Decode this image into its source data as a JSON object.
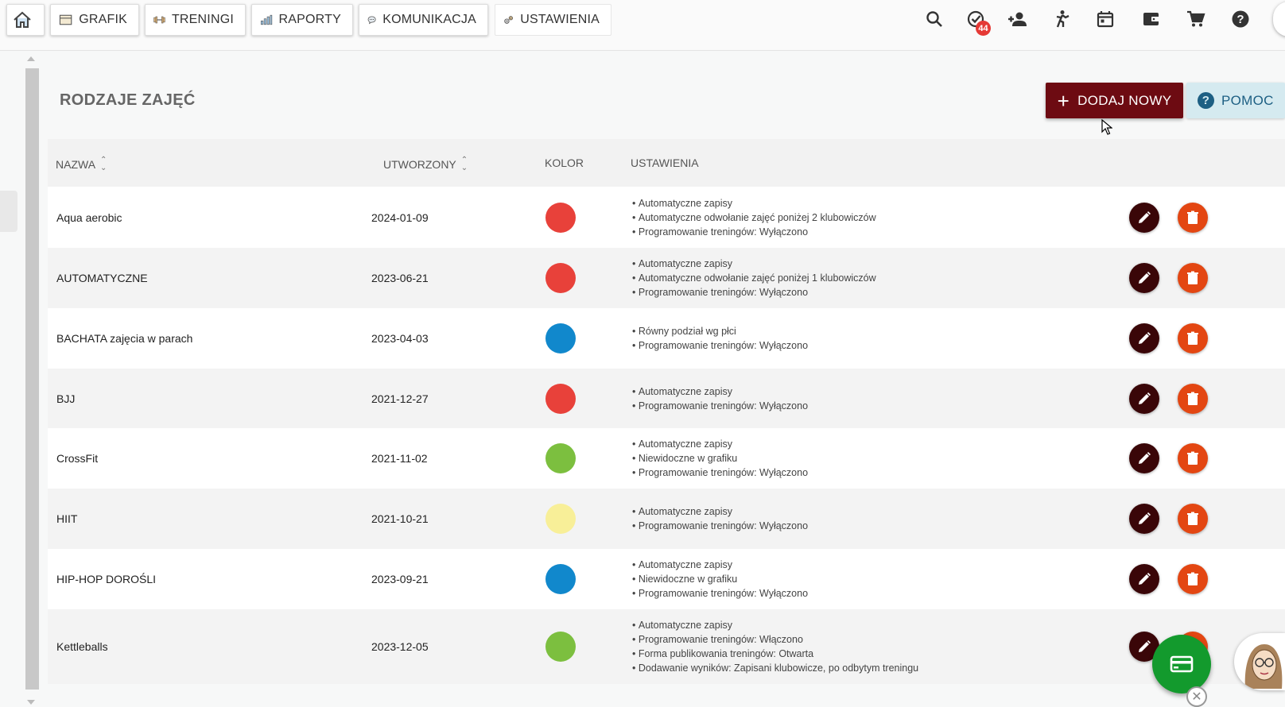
{
  "nav": {
    "items": [
      {
        "label": "GRAFIK",
        "icon": "calendar-grid-icon"
      },
      {
        "label": "TRENINGI",
        "icon": "dumbbell-icon"
      },
      {
        "label": "RAPORTY",
        "icon": "bar-chart-icon"
      },
      {
        "label": "KOMUNIKACJA",
        "icon": "chat-bubble-icon"
      },
      {
        "label": "USTAWIENIA",
        "icon": "gears-icon"
      }
    ],
    "tasks_badge": "44"
  },
  "page": {
    "title": "RODZAJE ZAJĘĆ",
    "add_button": "DODAJ NOWY",
    "help_button": "POMOC"
  },
  "table": {
    "headers": {
      "name": "NAZWA",
      "created": "UTWORZONY",
      "color": "KOLOR",
      "settings": "USTAWIENIA"
    },
    "rows": [
      {
        "name": "Aqua aerobic",
        "created": "2024-01-09",
        "color": "#e8413a",
        "settings": [
          "Automatyczne zapisy",
          "Automatyczne odwołanie zajęć poniżej 2 klubowiczów",
          "Programowanie treningów: Wyłączono"
        ]
      },
      {
        "name": "AUTOMATYCZNE",
        "created": "2023-06-21",
        "color": "#e8413a",
        "settings": [
          "Automatyczne zapisy",
          "Automatyczne odwołanie zajęć poniżej 1 klubowiczów",
          "Programowanie treningów: Wyłączono"
        ]
      },
      {
        "name": "BACHATA zajęcia w parach",
        "created": "2023-04-03",
        "color": "#1188cc",
        "settings": [
          "Równy podział wg płci",
          "Programowanie treningów: Wyłączono"
        ]
      },
      {
        "name": "BJJ",
        "created": "2021-12-27",
        "color": "#e8413a",
        "settings": [
          "Automatyczne zapisy",
          "Programowanie treningów: Wyłączono"
        ]
      },
      {
        "name": "CrossFit",
        "created": "2021-11-02",
        "color": "#7cbf3f",
        "settings": [
          "Automatyczne zapisy",
          "Niewidoczne w grafiku",
          "Programowanie treningów: Wyłączono"
        ]
      },
      {
        "name": "HIIT",
        "created": "2021-10-21",
        "color": "#f8ef98",
        "settings": [
          "Automatyczne zapisy",
          "Programowanie treningów: Wyłączono"
        ]
      },
      {
        "name": "HIP-HOP DOROŚLI",
        "created": "2023-09-21",
        "color": "#1188cc",
        "settings": [
          "Automatyczne zapisy",
          "Niewidoczne w grafiku",
          "Programowanie treningów: Wyłączono"
        ]
      },
      {
        "name": "Kettleballs",
        "created": "2023-12-05",
        "color": "#7cbf3f",
        "settings": [
          "Automatyczne zapisy",
          "Programowanie treningów: Włączono",
          "Forma publikowania treningów: Otwarta",
          "Dodawanie wyników: Zapisani klubowicze, po odbytym treningu"
        ]
      }
    ]
  },
  "colors": {
    "accent_dark": "#6d0b12",
    "edit": "#3a0608",
    "delete": "#e34612",
    "fab": "#139a2d",
    "help_bg": "#d5eaf0"
  }
}
